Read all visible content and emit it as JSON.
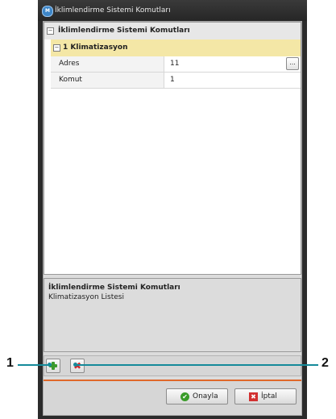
{
  "window": {
    "title": "İklimlendirme Sistemi Komutları",
    "icon": "app-logo-icon"
  },
  "grid": {
    "category": {
      "label": "İklimlendirme Sistemi Komutları",
      "toggle": "⊟"
    },
    "subcategory": {
      "label": "1 Klimatizasyon",
      "toggle": "⊟"
    },
    "properties": [
      {
        "name": "Adres",
        "value": "11",
        "button": "..."
      },
      {
        "name": "Komut",
        "value": "1"
      }
    ]
  },
  "description": {
    "title": "İklimlendirme Sistemi Komutları",
    "text": "Klimatizasyon Listesi"
  },
  "toolbar": {
    "add_icon": "add-icon",
    "remove_icon": "delete-icon",
    "remove_glyph": "✖"
  },
  "footer": {
    "ok_label": "Onayla",
    "cancel_label": "İptal",
    "ok_glyph": "✔",
    "cancel_glyph": "✖"
  },
  "callouts": {
    "left": "1",
    "right": "2"
  },
  "colors": {
    "accent_line": "#e0682a",
    "callout_line": "#158a9a",
    "subcategory_bg": "#f4e7a6"
  }
}
